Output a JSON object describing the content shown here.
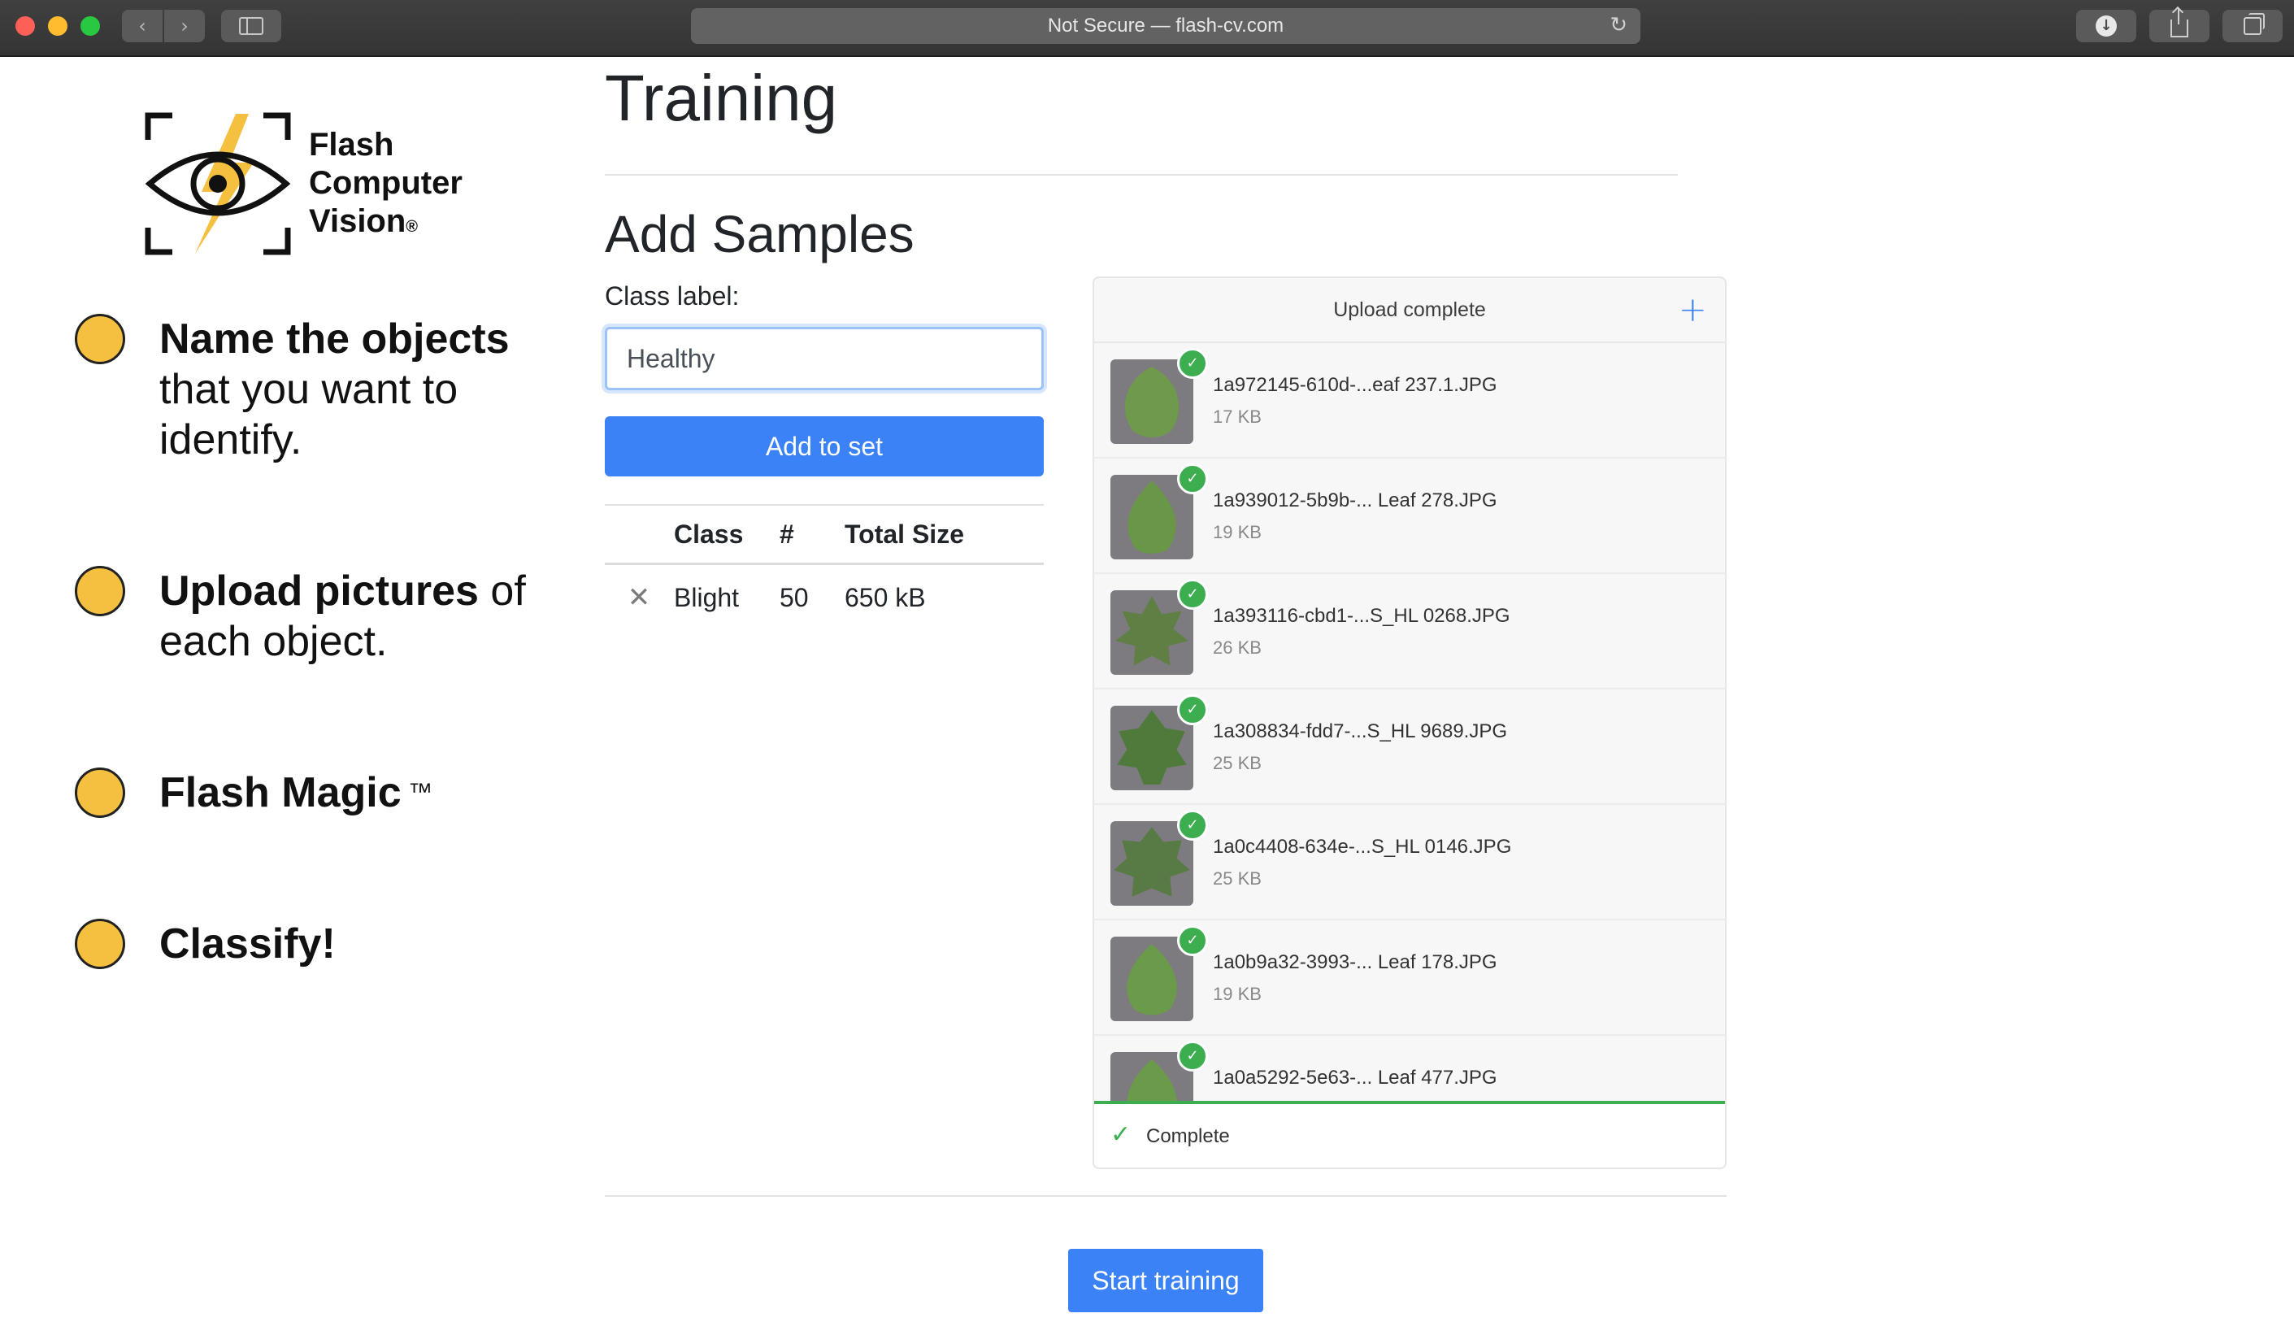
{
  "browser": {
    "address": "Not Secure — flash-cv.com",
    "back_glyph": "‹",
    "forward_glyph": "›",
    "reload_glyph": "↻",
    "download_glyph": "↓"
  },
  "brand": {
    "line1": "Flash",
    "line2": "Computer",
    "line3": "Vision",
    "reg": "®"
  },
  "steps": [
    {
      "bold": "Name the objects",
      "rest": " that you want to identify."
    },
    {
      "bold": "Upload pictures",
      "rest": " of each object."
    },
    {
      "bold": "Flash Magic",
      "rest": " ™"
    },
    {
      "bold": "Classify!",
      "rest": ""
    }
  ],
  "main": {
    "title": "Training",
    "section_title": "Add Samples",
    "class_label": "Class label:",
    "class_value": "Healthy",
    "add_button": "Add to set",
    "table": {
      "headers": [
        "",
        "Class",
        "#",
        "Total Size"
      ],
      "rows": [
        {
          "remove": "✕",
          "class": "Blight",
          "count": "50",
          "size": "650 kB"
        }
      ]
    },
    "start_button": "Start training"
  },
  "upload": {
    "header": "Upload complete",
    "add_icon": "+",
    "check_glyph": "✓",
    "files": [
      {
        "name": "1a972145-610d-...eaf 237.1.JPG",
        "size": "17 KB"
      },
      {
        "name": "1a939012-5b9b-... Leaf 278.JPG",
        "size": "19 KB"
      },
      {
        "name": "1a393116-cbd1-...S_HL 0268.JPG",
        "size": "26 KB"
      },
      {
        "name": "1a308834-fdd7-...S_HL 9689.JPG",
        "size": "25 KB"
      },
      {
        "name": "1a0c4408-634e-...S_HL 0146.JPG",
        "size": "25 KB"
      },
      {
        "name": "1a0b9a32-3993-... Leaf 178.JPG",
        "size": "19 KB"
      },
      {
        "name": "1a0a5292-5e63-... Leaf 477.JPG",
        "size": ""
      }
    ],
    "footer_text": "Complete",
    "progress_fraction": 1.0
  },
  "colors": {
    "accent": "#3a82f6",
    "success": "#3dae4f",
    "step_dot": "#f5bf3f"
  }
}
